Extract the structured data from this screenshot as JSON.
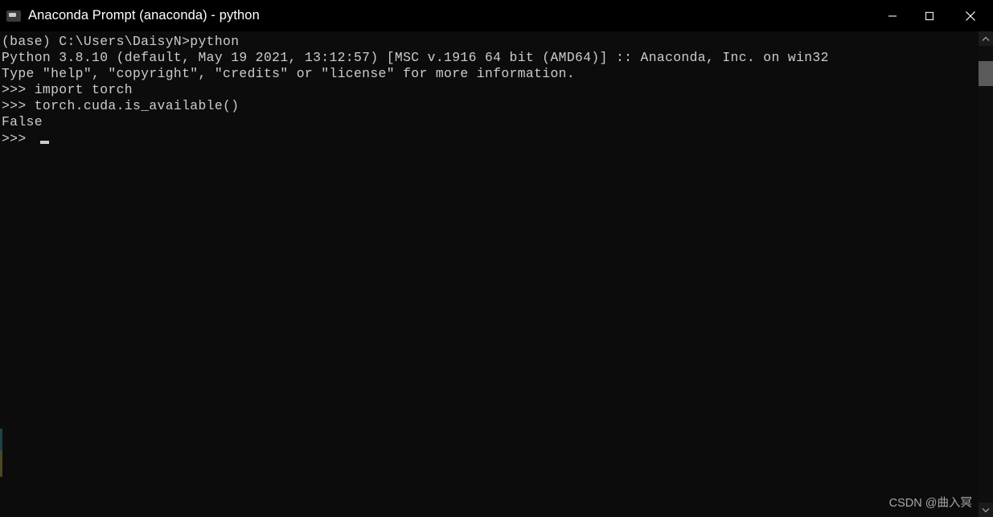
{
  "window": {
    "title": "Anaconda Prompt (anaconda) - python",
    "icon": "console-icon",
    "background_color": "#0c0c0c",
    "titlebar_color": "#000000",
    "text_color": "#cccccc"
  },
  "titlebar_controls": {
    "minimize_label": "—",
    "maximize_label": "☐",
    "close_label": "✕"
  },
  "terminal": {
    "lines": [
      "(base) C:\\Users\\DaisyN>python",
      "Python 3.8.10 (default, May 19 2021, 13:12:57) [MSC v.1916 64 bit (AMD64)] :: Anaconda, Inc. on win32",
      "Type \"help\", \"copyright\", \"credits\" or \"license\" for more information.",
      ">>> import torch",
      ">>> torch.cuda.is_available()",
      "False"
    ],
    "prompt": ">>> ",
    "cursor": "block-cursor"
  },
  "scrollbar": {
    "up_arrow": "chevron-up-icon",
    "down_arrow": "chevron-down-icon",
    "thumb": "scrollbar-thumb"
  },
  "watermark": {
    "text": "CSDN @曲入冥"
  }
}
